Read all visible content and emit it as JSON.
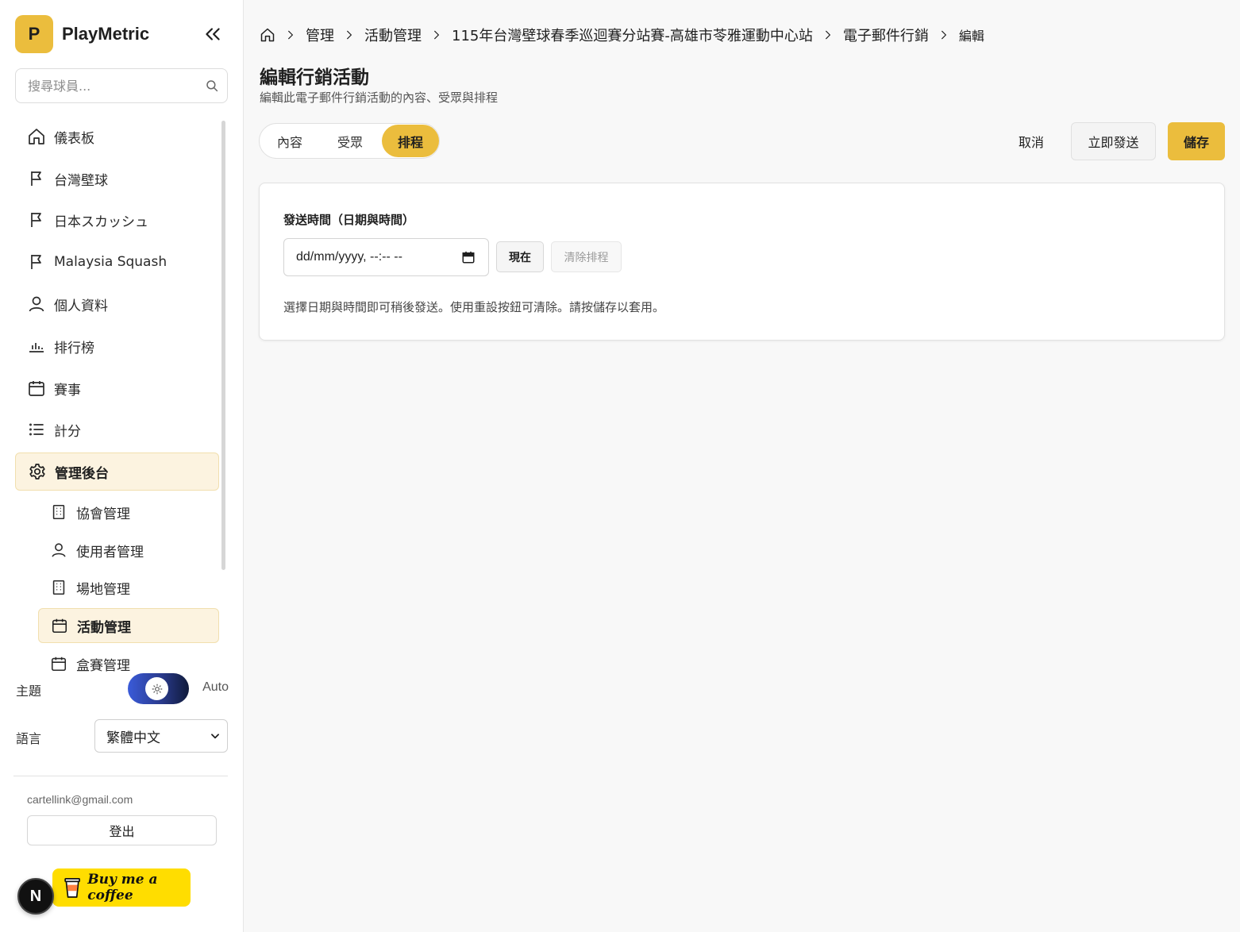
{
  "app": {
    "brand_letter": "P",
    "brand_name": "PlayMetric",
    "accent_color": "#ebbd3d"
  },
  "sidebar": {
    "search_placeholder": "搜尋球員...",
    "items": [
      {
        "label": "儀表板",
        "icon": "home-icon"
      },
      {
        "label": "台灣壁球",
        "icon": "flag-icon"
      },
      {
        "label": "日本スカッシュ",
        "icon": "flag-icon"
      },
      {
        "label": "Malaysia Squash",
        "icon": "flag-icon"
      },
      {
        "label": "個人資料",
        "icon": "user-icon"
      },
      {
        "label": "排行榜",
        "icon": "bar-chart-icon"
      },
      {
        "label": "賽事",
        "icon": "calendar-icon"
      },
      {
        "label": "計分",
        "icon": "list-icon"
      },
      {
        "label": "管理後台",
        "icon": "gear-icon",
        "active": true
      }
    ],
    "sub_items": [
      {
        "label": "協會管理",
        "icon": "building-icon"
      },
      {
        "label": "使用者管理",
        "icon": "user-icon"
      },
      {
        "label": "場地管理",
        "icon": "building-icon"
      },
      {
        "label": "活動管理",
        "icon": "calendar-icon",
        "active": true
      },
      {
        "label": "盒賽管理",
        "icon": "calendar-icon"
      }
    ],
    "theme_label": "主題",
    "theme_value": "Auto",
    "language_label": "語言",
    "language_value": "繁體中文",
    "user_email": "cartellink@gmail.com",
    "logout_label": "登出",
    "n_badge": "N",
    "coffee_label": "Buy me a coffee"
  },
  "breadcrumb": {
    "items": [
      "管理",
      "活動管理",
      "115年台灣壁球春季巡迴賽分站賽-高雄市苓雅運動中心站",
      "電子郵件行銷"
    ],
    "current": "編輯"
  },
  "page": {
    "title": "編輯行銷活動",
    "subtitle": "編輯此電子郵件行銷活動的內容、受眾與排程"
  },
  "tabs": {
    "content": "內容",
    "audience": "受眾",
    "schedule": "排程",
    "active": "排程"
  },
  "actions": {
    "cancel": "取消",
    "send_now": "立即發送",
    "save": "儲存"
  },
  "schedule": {
    "field_label": "發送時間（日期與時間）",
    "datetime_value": "dd/mm/yyyy, --:-- --",
    "now_button": "現在",
    "clear_button": "清除排程",
    "helper_text": "選擇日期與時間即可稍後發送。使用重設按鈕可清除。請按儲存以套用。"
  }
}
